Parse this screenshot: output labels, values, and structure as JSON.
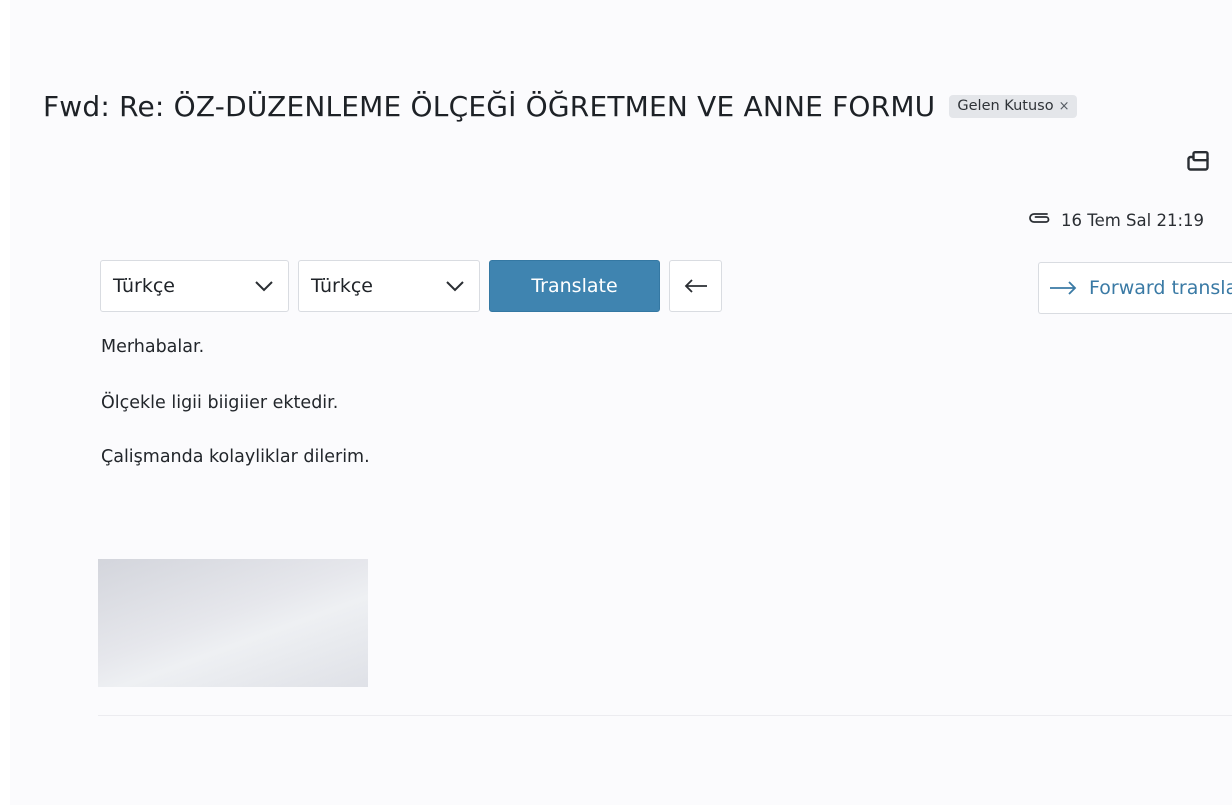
{
  "email": {
    "subject": "Fwd: Re: ÖZ-DÜZENLEME ÖLÇEĞİ ÖĞRETMEN VE ANNE FORMU",
    "folder_badge": "Gelen Kutuso",
    "folder_badge_close": "×",
    "date": "16 Tem Sal 21:19",
    "body_lines": [
      "Merhabalar.",
      "Ölçekle ligii biigiier ektedir.",
      "Çalişmanda kolayliklar dilerim."
    ]
  },
  "translator": {
    "source_language": "Türkçe",
    "target_language": "Türkçe",
    "translate_label": "Translate",
    "forward_label": "Forward transla"
  },
  "colors": {
    "accent": "#3f84b0",
    "link": "#3a7aa5",
    "badge_bg": "#e4e6ea"
  },
  "icons": {
    "popout": "popout-window-icon",
    "attachment": "paperclip-icon",
    "back": "arrow-left-icon",
    "forward": "arrow-right-icon",
    "dropdown": "chevron-down-icon"
  }
}
